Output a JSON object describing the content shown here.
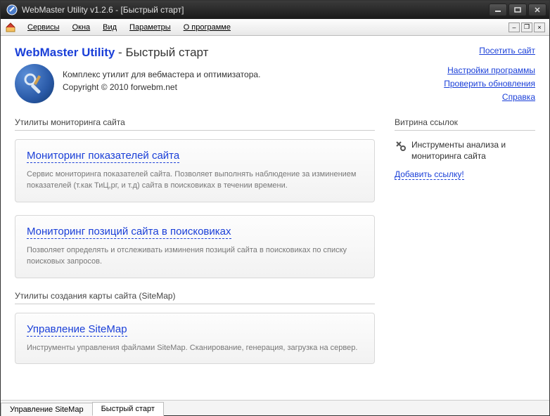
{
  "window": {
    "title": "WebMaster Utility v1.2.6 - [Быстрый старт]"
  },
  "menu": {
    "services": "Сервисы",
    "windows": "Окна",
    "view": "Вид",
    "params": "Параметры",
    "about": "О программе"
  },
  "header": {
    "brand": "WebMaster Utility",
    "sep": " - ",
    "subtitle": "Быстрый старт",
    "visit": "Посетить сайт"
  },
  "intro": {
    "line1": "Комплекс утилит для вебмастера и оптимизатора.",
    "line2": "Copyright © 2010 forwebm.net"
  },
  "links": {
    "settings": "Настройки программы",
    "updates": "Проверить обновления",
    "help": "Справка"
  },
  "sections": {
    "monitoring": "Утилиты мониторинга сайта",
    "sitemap": "Утилиты создания карты сайта (SiteMap)",
    "showcase": "Витрина ссылок"
  },
  "cards": {
    "mon1": {
      "title": "Мониторинг показателей сайта",
      "desc": "Сервис мониторинга показателей сайта. Позволяет выполнять наблюдение за изминением показателей (т.как ТиЦ,рг, и т.д) сайта в поисковиках в течении времени."
    },
    "mon2": {
      "title": "Мониторинг позиций сайта в поисковиках",
      "desc": "Позволяет определять и отслеживать изминения позиций сайта в поисковиках по списку поисковых запросов."
    },
    "sm1": {
      "title": "Управление SiteMap",
      "desc": "Инструменты управления файлами SiteMap. Сканирование, генерация, загрузка на сервер."
    }
  },
  "showcase": {
    "item1": "Инструменты анализа и мониторинга сайта",
    "add": "Добавить ссылку!"
  },
  "tabs": {
    "t1": "Управление SiteMap",
    "t2": "Быстрый старт"
  }
}
